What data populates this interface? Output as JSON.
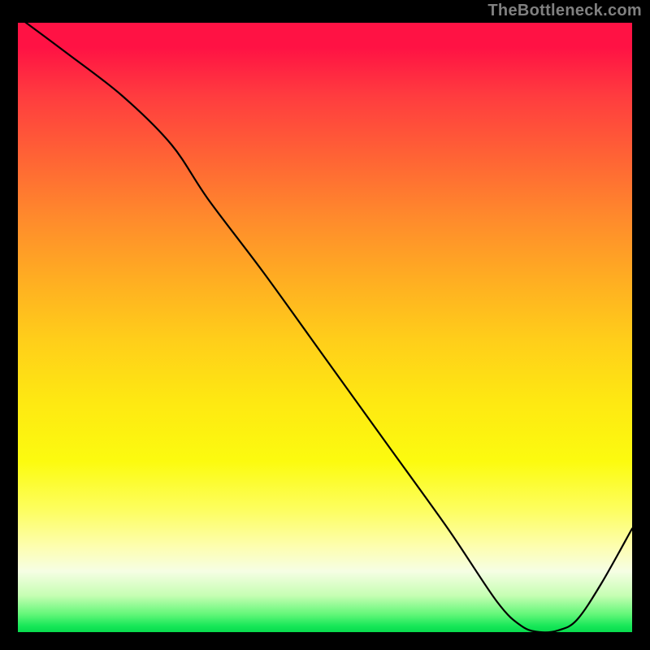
{
  "source_label": "TheBottleneck.com",
  "bottom_label_text": "",
  "chart_data": {
    "type": "line",
    "title": "",
    "xlabel": "",
    "ylabel": "",
    "ylim": [
      0,
      100
    ],
    "xlim": [
      0,
      100
    ],
    "series": [
      {
        "name": "curve",
        "points": [
          {
            "x": 0,
            "y": 101
          },
          {
            "x": 8,
            "y": 95
          },
          {
            "x": 17,
            "y": 88
          },
          {
            "x": 25,
            "y": 80
          },
          {
            "x": 31,
            "y": 71
          },
          {
            "x": 40,
            "y": 59
          },
          {
            "x": 50,
            "y": 45
          },
          {
            "x": 60,
            "y": 31
          },
          {
            "x": 70,
            "y": 17
          },
          {
            "x": 78,
            "y": 5
          },
          {
            "x": 82,
            "y": 1
          },
          {
            "x": 85,
            "y": 0
          },
          {
            "x": 88,
            "y": 0.3
          },
          {
            "x": 91,
            "y": 2
          },
          {
            "x": 95,
            "y": 8
          },
          {
            "x": 100,
            "y": 17
          }
        ]
      }
    ],
    "gradient_stops": [
      {
        "pct": 0,
        "color": "#ff1244"
      },
      {
        "pct": 50,
        "color": "#ffce1a"
      },
      {
        "pct": 75,
        "color": "#fcfb0f"
      },
      {
        "pct": 95,
        "color": "#65f77a"
      },
      {
        "pct": 100,
        "color": "#08db4e"
      }
    ]
  }
}
